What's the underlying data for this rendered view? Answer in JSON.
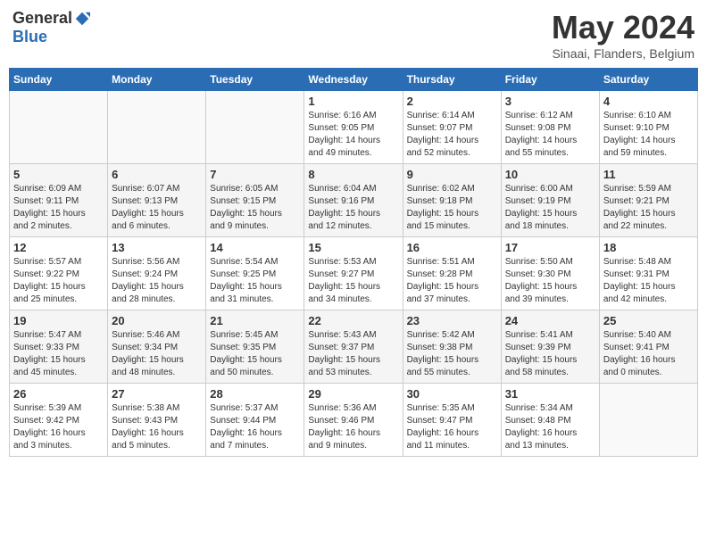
{
  "header": {
    "logo_general": "General",
    "logo_blue": "Blue",
    "month_title": "May 2024",
    "location": "Sinaai, Flanders, Belgium"
  },
  "days_of_week": [
    "Sunday",
    "Monday",
    "Tuesday",
    "Wednesday",
    "Thursday",
    "Friday",
    "Saturday"
  ],
  "weeks": [
    {
      "days": [
        {
          "number": "",
          "info": ""
        },
        {
          "number": "",
          "info": ""
        },
        {
          "number": "",
          "info": ""
        },
        {
          "number": "1",
          "info": "Sunrise: 6:16 AM\nSunset: 9:05 PM\nDaylight: 14 hours\nand 49 minutes."
        },
        {
          "number": "2",
          "info": "Sunrise: 6:14 AM\nSunset: 9:07 PM\nDaylight: 14 hours\nand 52 minutes."
        },
        {
          "number": "3",
          "info": "Sunrise: 6:12 AM\nSunset: 9:08 PM\nDaylight: 14 hours\nand 55 minutes."
        },
        {
          "number": "4",
          "info": "Sunrise: 6:10 AM\nSunset: 9:10 PM\nDaylight: 14 hours\nand 59 minutes."
        }
      ]
    },
    {
      "days": [
        {
          "number": "5",
          "info": "Sunrise: 6:09 AM\nSunset: 9:11 PM\nDaylight: 15 hours\nand 2 minutes."
        },
        {
          "number": "6",
          "info": "Sunrise: 6:07 AM\nSunset: 9:13 PM\nDaylight: 15 hours\nand 6 minutes."
        },
        {
          "number": "7",
          "info": "Sunrise: 6:05 AM\nSunset: 9:15 PM\nDaylight: 15 hours\nand 9 minutes."
        },
        {
          "number": "8",
          "info": "Sunrise: 6:04 AM\nSunset: 9:16 PM\nDaylight: 15 hours\nand 12 minutes."
        },
        {
          "number": "9",
          "info": "Sunrise: 6:02 AM\nSunset: 9:18 PM\nDaylight: 15 hours\nand 15 minutes."
        },
        {
          "number": "10",
          "info": "Sunrise: 6:00 AM\nSunset: 9:19 PM\nDaylight: 15 hours\nand 18 minutes."
        },
        {
          "number": "11",
          "info": "Sunrise: 5:59 AM\nSunset: 9:21 PM\nDaylight: 15 hours\nand 22 minutes."
        }
      ]
    },
    {
      "days": [
        {
          "number": "12",
          "info": "Sunrise: 5:57 AM\nSunset: 9:22 PM\nDaylight: 15 hours\nand 25 minutes."
        },
        {
          "number": "13",
          "info": "Sunrise: 5:56 AM\nSunset: 9:24 PM\nDaylight: 15 hours\nand 28 minutes."
        },
        {
          "number": "14",
          "info": "Sunrise: 5:54 AM\nSunset: 9:25 PM\nDaylight: 15 hours\nand 31 minutes."
        },
        {
          "number": "15",
          "info": "Sunrise: 5:53 AM\nSunset: 9:27 PM\nDaylight: 15 hours\nand 34 minutes."
        },
        {
          "number": "16",
          "info": "Sunrise: 5:51 AM\nSunset: 9:28 PM\nDaylight: 15 hours\nand 37 minutes."
        },
        {
          "number": "17",
          "info": "Sunrise: 5:50 AM\nSunset: 9:30 PM\nDaylight: 15 hours\nand 39 minutes."
        },
        {
          "number": "18",
          "info": "Sunrise: 5:48 AM\nSunset: 9:31 PM\nDaylight: 15 hours\nand 42 minutes."
        }
      ]
    },
    {
      "days": [
        {
          "number": "19",
          "info": "Sunrise: 5:47 AM\nSunset: 9:33 PM\nDaylight: 15 hours\nand 45 minutes."
        },
        {
          "number": "20",
          "info": "Sunrise: 5:46 AM\nSunset: 9:34 PM\nDaylight: 15 hours\nand 48 minutes."
        },
        {
          "number": "21",
          "info": "Sunrise: 5:45 AM\nSunset: 9:35 PM\nDaylight: 15 hours\nand 50 minutes."
        },
        {
          "number": "22",
          "info": "Sunrise: 5:43 AM\nSunset: 9:37 PM\nDaylight: 15 hours\nand 53 minutes."
        },
        {
          "number": "23",
          "info": "Sunrise: 5:42 AM\nSunset: 9:38 PM\nDaylight: 15 hours\nand 55 minutes."
        },
        {
          "number": "24",
          "info": "Sunrise: 5:41 AM\nSunset: 9:39 PM\nDaylight: 15 hours\nand 58 minutes."
        },
        {
          "number": "25",
          "info": "Sunrise: 5:40 AM\nSunset: 9:41 PM\nDaylight: 16 hours\nand 0 minutes."
        }
      ]
    },
    {
      "days": [
        {
          "number": "26",
          "info": "Sunrise: 5:39 AM\nSunset: 9:42 PM\nDaylight: 16 hours\nand 3 minutes."
        },
        {
          "number": "27",
          "info": "Sunrise: 5:38 AM\nSunset: 9:43 PM\nDaylight: 16 hours\nand 5 minutes."
        },
        {
          "number": "28",
          "info": "Sunrise: 5:37 AM\nSunset: 9:44 PM\nDaylight: 16 hours\nand 7 minutes."
        },
        {
          "number": "29",
          "info": "Sunrise: 5:36 AM\nSunset: 9:46 PM\nDaylight: 16 hours\nand 9 minutes."
        },
        {
          "number": "30",
          "info": "Sunrise: 5:35 AM\nSunset: 9:47 PM\nDaylight: 16 hours\nand 11 minutes."
        },
        {
          "number": "31",
          "info": "Sunrise: 5:34 AM\nSunset: 9:48 PM\nDaylight: 16 hours\nand 13 minutes."
        },
        {
          "number": "",
          "info": ""
        }
      ]
    }
  ]
}
